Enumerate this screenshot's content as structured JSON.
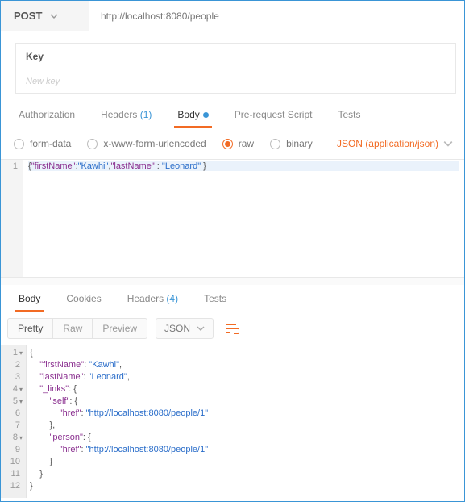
{
  "request": {
    "method": "POST",
    "url": "http://localhost:8080/people"
  },
  "keyval": {
    "header": "Key",
    "placeholder": "New key"
  },
  "req_tabs": {
    "auth": "Authorization",
    "headers": "Headers",
    "headers_count": "(1)",
    "body": "Body",
    "prerequest": "Pre-request Script",
    "tests": "Tests"
  },
  "body_opts": {
    "form": "form-data",
    "urlencoded": "x-www-form-urlencoded",
    "raw": "raw",
    "binary": "binary",
    "content_type": "JSON (application/json)"
  },
  "req_body": {
    "line1_key1": "\"firstName\"",
    "line1_val1": "\"Kawhi\"",
    "line1_key2": "\"lastName\"",
    "line1_val2": "\"Leonard\""
  },
  "resp_tabs": {
    "body": "Body",
    "cookies": "Cookies",
    "headers": "Headers",
    "headers_count": "(4)",
    "tests": "Tests"
  },
  "resp_toolbar": {
    "pretty": "Pretty",
    "raw": "Raw",
    "preview": "Preview",
    "format": "JSON"
  },
  "resp_body": {
    "k_firstName": "\"firstName\"",
    "v_firstName": "\"Kawhi\"",
    "k_lastName": "\"lastName\"",
    "v_lastName": "\"Leonard\"",
    "k_links": "\"_links\"",
    "k_self": "\"self\"",
    "k_href": "\"href\"",
    "v_href": "\"http://localhost:8080/people/1\"",
    "k_person": "\"person\""
  },
  "chart_data": null
}
